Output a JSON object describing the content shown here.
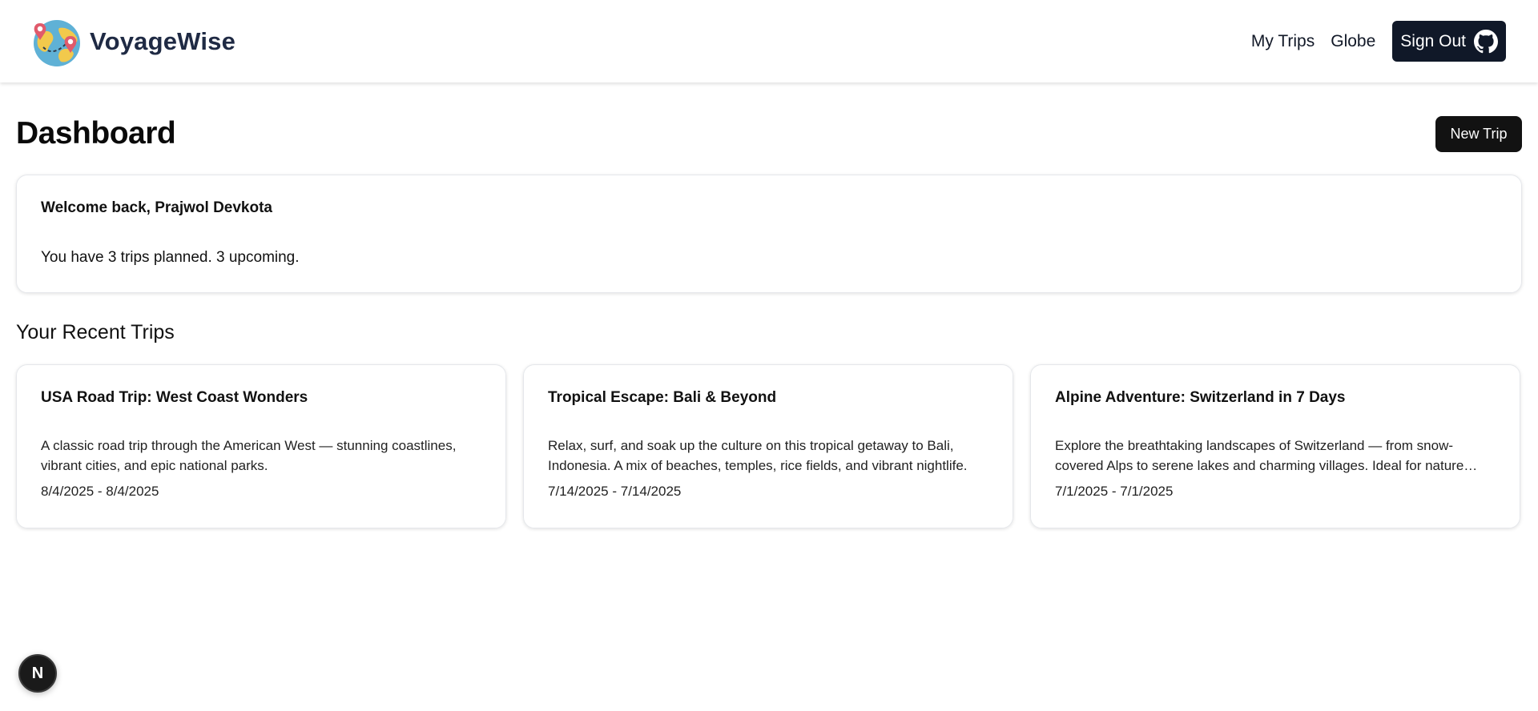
{
  "header": {
    "brand_name": "VoyageWise",
    "logo_icon": "globe-map-pin-icon",
    "nav": {
      "my_trips": "My Trips",
      "globe": "Globe",
      "sign_out": "Sign Out"
    },
    "sign_out_icon": "github-icon"
  },
  "main": {
    "page_title": "Dashboard",
    "new_trip_label": "New Trip",
    "welcome": {
      "title": "Welcome back, Prajwol Devkota",
      "text": "You have 3 trips planned. 3 upcoming."
    },
    "recent_title": "Your Recent Trips",
    "trips": [
      {
        "title": "USA Road Trip: West Coast Wonders",
        "description": "A classic road trip through the American West — stunning coastlines, vibrant cities, and epic national parks.",
        "dates": "8/4/2025 - 8/4/2025"
      },
      {
        "title": "Tropical Escape: Bali & Beyond",
        "description": "Relax, surf, and soak up the culture on this tropical getaway to Bali, Indonesia. A mix of beaches, temples, rice fields, and vibrant nightlife.",
        "dates": "7/14/2025 - 7/14/2025"
      },
      {
        "title": "Alpine Adventure: Switzerland in 7 Days",
        "description": "Explore the breathtaking landscapes of Switzerland — from snow-covered Alps to serene lakes and charming villages. Ideal for nature lovers.",
        "dates": "7/1/2025 - 7/1/2025"
      }
    ]
  },
  "dev_badge": {
    "label": "N",
    "icon": "nextjs-icon"
  },
  "colors": {
    "brand_text": "#1f2a44",
    "dark_button": "#101828",
    "new_trip_button": "#121212",
    "card_border": "#e5e7eb"
  }
}
